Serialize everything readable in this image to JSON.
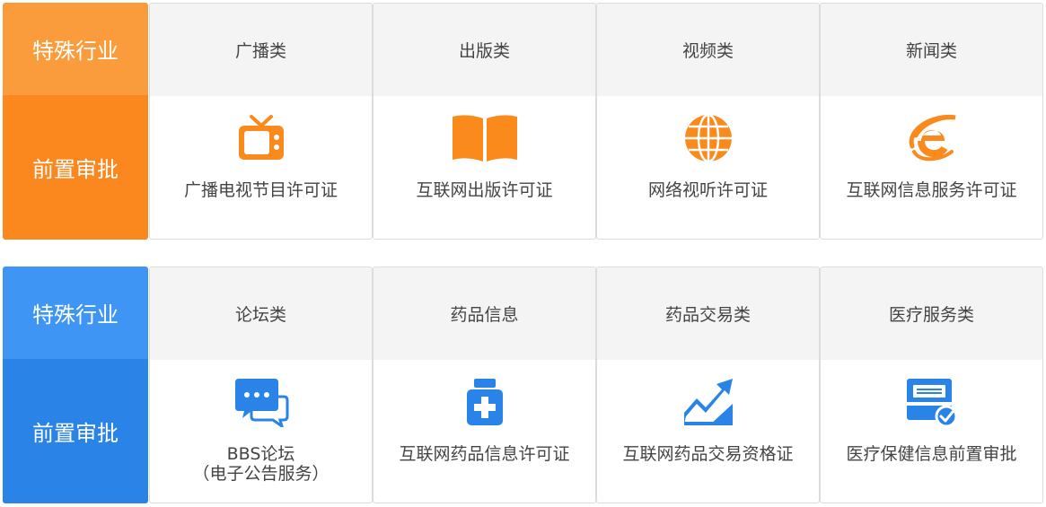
{
  "sections": [
    {
      "side_top": "特殊行业",
      "side_bottom": "前置审批",
      "cards": [
        {
          "category": "广播类",
          "icon": "tv-icon",
          "license": "广播电视节目许可证"
        },
        {
          "category": "出版类",
          "icon": "open-book-icon",
          "license": "互联网出版许可证"
        },
        {
          "category": "视频类",
          "icon": "globe-icon",
          "license": "网络视听许可证"
        },
        {
          "category": "新闻类",
          "icon": "internet-explorer-icon",
          "license": "互联网信息服务许可证"
        }
      ]
    },
    {
      "side_top": "特殊行业",
      "side_bottom": "前置审批",
      "cards": [
        {
          "category": "论坛类",
          "icon": "chat-bubbles-icon",
          "license": "BBS论坛",
          "license_line2": "（电子公告服务）"
        },
        {
          "category": "药品信息",
          "icon": "medicine-bottle-icon",
          "license": "互联网药品信息许可证"
        },
        {
          "category": "药品交易类",
          "icon": "trend-chart-icon",
          "license": "互联网药品交易资格证"
        },
        {
          "category": "医疗服务类",
          "icon": "approved-document-icon",
          "license": "医疗保健信息前置审批"
        }
      ]
    }
  ],
  "colors": {
    "orange_top": "#fb9c3c",
    "orange_bottom": "#fb871f",
    "blue_top": "#3f95f4",
    "blue_bottom": "#2a83e6"
  }
}
